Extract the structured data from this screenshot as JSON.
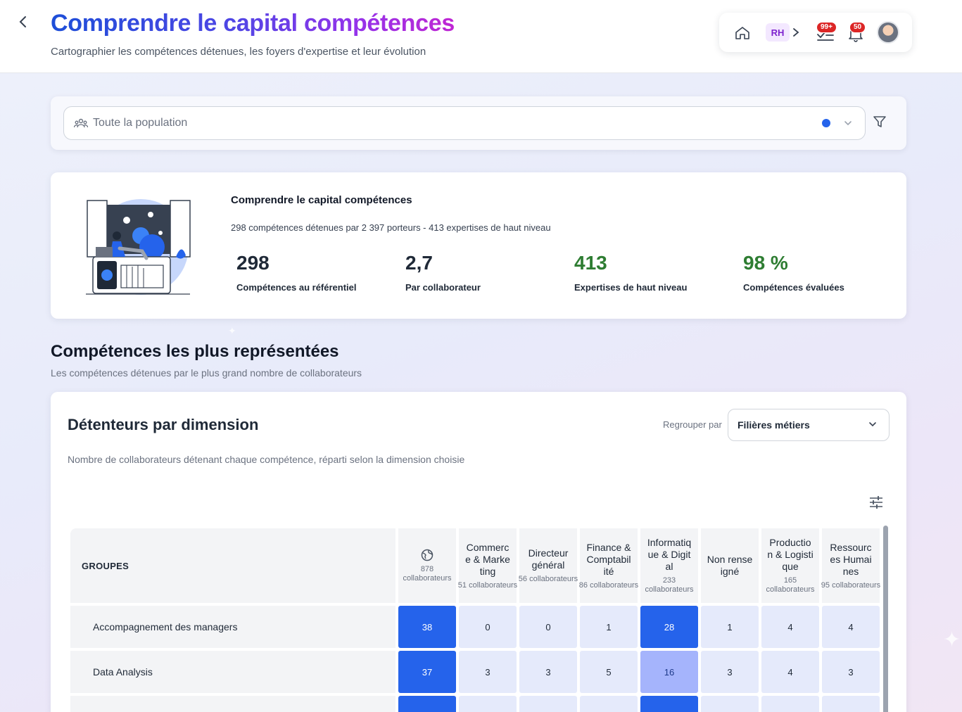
{
  "header": {
    "title": "Comprendre le capital compétences",
    "subtitle": "Cartographier les compétences détenues, les foyers d'expertise et leur évolution",
    "role_chip": "RH",
    "tasks_badge": "99+",
    "notifications_badge": "50"
  },
  "population_filter": {
    "value": "Toute la population",
    "indicator_color": "#2563eb"
  },
  "summary": {
    "title": "Comprendre le capital compétences",
    "description": "298 compétences détenues par 2 397 porteurs - 413 expertises de haut niveau",
    "kpis": [
      {
        "value": "298",
        "label": "Compétences au référentiel"
      },
      {
        "value": "2,7",
        "label": "Par collaborateur"
      },
      {
        "value": "413",
        "label": "Expertises de haut niveau"
      },
      {
        "value": "98 %",
        "label": "Compétences évaluées"
      }
    ]
  },
  "section": {
    "title": "Compétences les plus représentées",
    "subtitle": "Les compétences détenues par le plus grand nombre de collaborateurs"
  },
  "dimension_card": {
    "title": "Détenteurs par dimension",
    "description": "Nombre de collaborateurs détenant chaque compétence, réparti selon la dimension choisie",
    "group_by_label": "Regrouper par",
    "group_by_value": "Filières métiers"
  },
  "table": {
    "groups_header": "GROUPES",
    "columns": [
      {
        "name": "",
        "icon": "globe-icon",
        "count": "878 collaborateurs"
      },
      {
        "name": "Commerce & Marketing",
        "count": "51 collaborateurs"
      },
      {
        "name": "Directeur général",
        "count": "56 collaborateurs"
      },
      {
        "name": "Finance & Comptabilité",
        "count": "86 collaborateurs"
      },
      {
        "name": "Informatique & Digital",
        "count": "233 collaborateurs"
      },
      {
        "name": "Non renseigné",
        "count": ""
      },
      {
        "name": "Production & Logistique",
        "count": "165 collaborateurs"
      },
      {
        "name": "Ressources Humaines",
        "count": "95 collaborateurs"
      }
    ],
    "rows": [
      {
        "label": "Accompagnement des managers",
        "values": [
          "38",
          "0",
          "0",
          "1",
          "28",
          "1",
          "4",
          "4"
        ]
      },
      {
        "label": "Data Analysis",
        "values": [
          "37",
          "3",
          "3",
          "5",
          "16",
          "3",
          "4",
          "3"
        ]
      },
      {
        "label": "",
        "values": [
          "",
          "",
          "",
          "",
          "",
          "",
          "",
          ""
        ]
      }
    ]
  },
  "colors": {
    "cell_strong": "#2563eb",
    "cell_medium": "#a5b4fc",
    "cell_light": "#e5eafb",
    "accent_green": "#2e7d32"
  }
}
